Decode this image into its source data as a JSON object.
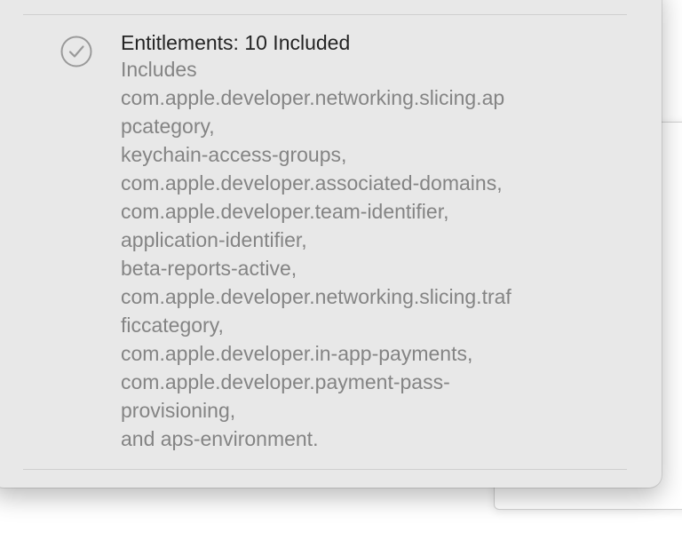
{
  "entitlements_popover": {
    "title": "Entitlements: 10 Included",
    "status_icon": "checkmark-circle-icon",
    "description_lines": [
      "Includes",
      "com.apple.developer.networking.slicing.ap",
      "pcategory,",
      "keychain-access-groups,",
      "com.apple.developer.associated-domains,",
      "com.apple.developer.team-identifier,",
      "application-identifier,",
      "beta-reports-active,",
      "com.apple.developer.networking.slicing.traf",
      "ficcategory,",
      "com.apple.developer.in-app-payments,",
      "com.apple.developer.payment-pass-",
      "provisioning,",
      "and aps-environment."
    ]
  },
  "colors": {
    "popover_background": "#e8e8e8",
    "title_text": "#242424",
    "secondary_text": "#848484",
    "icon": "#9a9a9a"
  }
}
